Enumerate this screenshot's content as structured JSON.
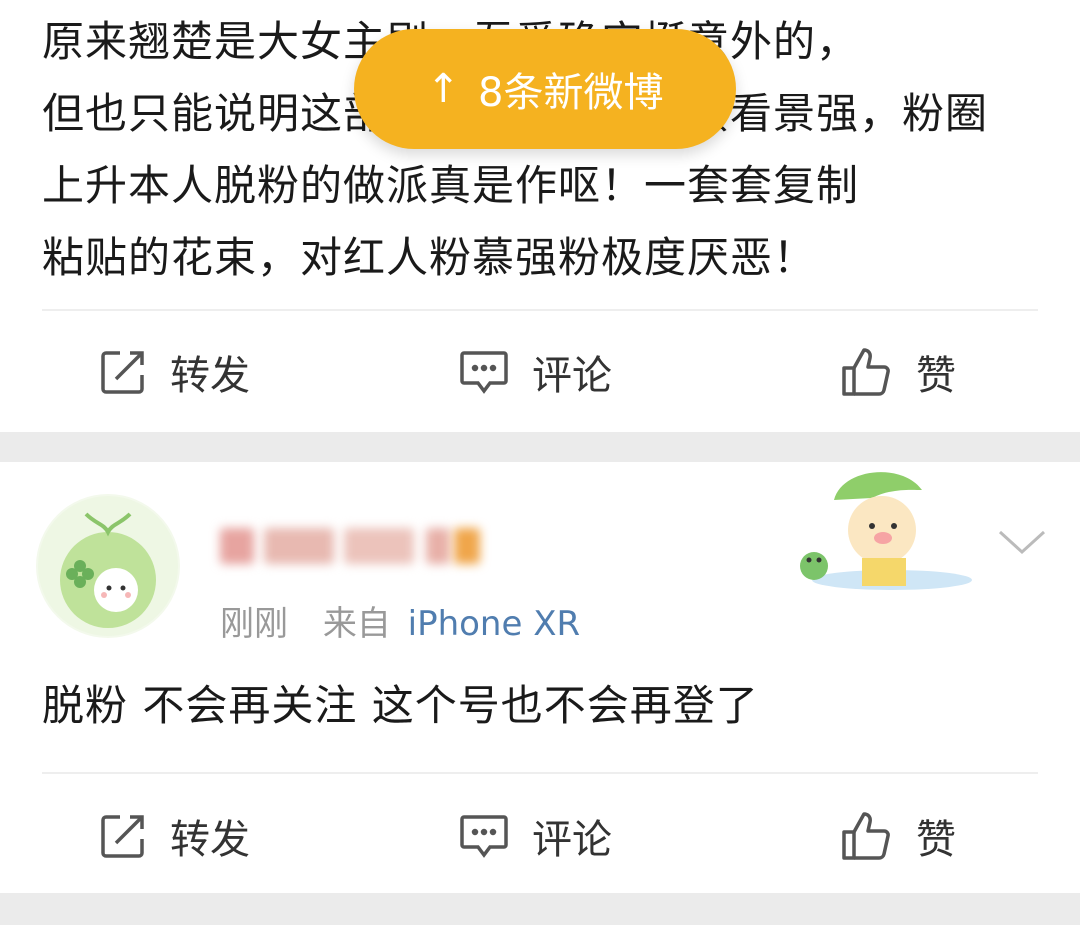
{
  "new_posts_pill": {
    "label": "8条新微博",
    "arrow": "↑"
  },
  "post1": {
    "lines": [
      "原来翘楚是大女主剧，吾爱确实挺意外的，",
      "但也只能说明这部剧本身质量还是蛮看景强，粉圈",
      "上升本人脱粉的做派真是作呕！一套套复制",
      "粘贴的花束，对红人粉慕强粉极度厌恶！"
    ],
    "actions": {
      "repost": "转发",
      "comment": "评论",
      "like": "赞"
    }
  },
  "post2": {
    "meta": {
      "time": "刚刚",
      "source_prefix": "来自",
      "device": "iPhone XR"
    },
    "text": "脱粉 不会再关注 这个号也不会再登了",
    "actions": {
      "repost": "转发",
      "comment": "评论",
      "like": "赞"
    }
  },
  "icons": {
    "repost": "repost-icon",
    "comment": "comment-icon",
    "like": "thumbs-up-icon",
    "expand": "chevron-down-icon"
  },
  "colors": {
    "pill": "#f5b220",
    "link": "#507daf",
    "meta": "#999999",
    "separator": "#ebebeb"
  }
}
